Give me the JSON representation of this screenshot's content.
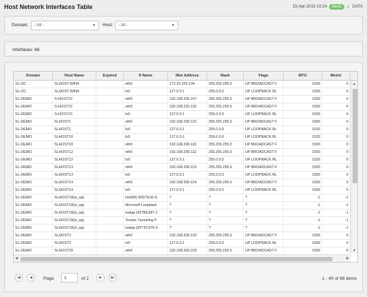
{
  "header": {
    "title": "Host Network Interfaces Table",
    "timestamp": "15-Apr-2019 10:24",
    "alerts_label": "Alerts",
    "data_label": "DATA"
  },
  "filters": {
    "domain_label": "Domain:",
    "domain_value": "- All -",
    "host_label": "Host:",
    "host_value": "- All -"
  },
  "summary": {
    "interfaces_label": "Interfaces: 66"
  },
  "table": {
    "columns": [
      "Domain",
      "Host Name",
      "Expired",
      "If Name",
      "INet Address",
      "Mask",
      "Flags",
      "MTU",
      "Metric"
    ],
    "rows": [
      [
        "SL-OC",
        "SLHOST-WIN4",
        "",
        "eth5",
        "172.16.200.134",
        "255.255.255.0",
        "UP BROADCAST F",
        "1500",
        "0"
      ],
      [
        "SL-OC",
        "SLHOST-WIN4",
        "",
        "lo0",
        "127.0.0.1",
        "255.0.0.0",
        "UP LOOPBACK RL",
        "1500",
        "0"
      ],
      [
        "SL-DEMO",
        "S-HOST10",
        "",
        "eth5",
        "192.168.200.167",
        "255.255.255.0",
        "UP BROADCAST F",
        "1500",
        "0"
      ],
      [
        "SL-DEMO",
        "S-HOST10",
        "",
        "eth9",
        "192.168.220.110",
        "255.255.255.0",
        "UP BROADCAST F",
        "1500",
        "0"
      ],
      [
        "SL-DEMO",
        "S-HOST10",
        "",
        "lo0",
        "127.0.0.1",
        "255.0.0.0",
        "UP LOOPBACK RL",
        "1500",
        "0"
      ],
      [
        "SL-DEMO",
        "SLHOST1",
        "",
        "eth0",
        "192.168.200.101",
        "255.255.255.0",
        "UP BROADCAST F",
        "1500",
        "0"
      ],
      [
        "SL-DEMO",
        "SLHOST1",
        "",
        "lo0",
        "127.0.0.1",
        "255.0.0.0",
        "UP LOOPBACK RL",
        "1520",
        "0"
      ],
      [
        "SL-DEMO",
        "SLHOST10",
        "",
        "lo0",
        "127.0.0.1",
        "255.0.0.0",
        "UP LOOPBACK RL",
        "1520",
        "0"
      ],
      [
        "SL-DEMO",
        "SLHOST10",
        "",
        "eth0",
        "192.168.200.110",
        "255.255.255.0",
        "UP BROADCAST F",
        "1500",
        "0"
      ],
      [
        "SL-DEMO",
        "SLHOST12",
        "",
        "eth0",
        "192.168.200.112",
        "255.255.255.0",
        "UP BROADCAST F",
        "1500",
        "0"
      ],
      [
        "SL-DEMO",
        "SLHOST12",
        "",
        "lo0",
        "127.0.0.1",
        "255.0.0.0",
        "UP LOOPBACK RL",
        "1520",
        "0"
      ],
      [
        "SL-DEMO",
        "SLHOST13",
        "",
        "eth6",
        "192.168.200.113",
        "255.255.255.0",
        "UP BROADCAST F",
        "1500",
        "0"
      ],
      [
        "SL-DEMO",
        "SLHOST13",
        "",
        "lo0",
        "127.0.0.1",
        "255.0.0.0",
        "UP LOOPBACK RL",
        "1500",
        "0"
      ],
      [
        "SL-DEMO",
        "SLHOST14",
        "",
        "eth6",
        "192.168.200.114",
        "255.255.255.0",
        "UP BROADCAST F",
        "1500",
        "0"
      ],
      [
        "SL-DEMO",
        "SLHOST14",
        "",
        "lo0",
        "127.0.0.1",
        "255.0.0.0",
        "UP LOOPBACK RL",
        "1500",
        "0"
      ],
      [
        "SL-DEMO",
        "SLHOST18(sl_qa)",
        "",
        "Intel(R) 82579LM G",
        "?",
        "?",
        "?",
        "-1",
        "-1"
      ],
      [
        "SL-DEMO",
        "SLHOST18(sl_qa)",
        "",
        "Microsoft Loopback",
        "?",
        "?",
        "?",
        "-1",
        "-1"
      ],
      [
        "SL-DEMO",
        "SLHOST18(sl_qa)",
        "",
        "isatap.{427BE387-1",
        "?",
        "?",
        "?",
        "-1",
        "-1"
      ],
      [
        "SL-DEMO",
        "SLHOST18(sl_qa)",
        "",
        "Teredo Tunneling P",
        "?",
        "?",
        "?",
        "-1",
        "-1"
      ],
      [
        "SL-DEMO",
        "SLHOST18(sl_qa)",
        "",
        "isatap.{3F73C479-3",
        "?",
        "?",
        "?",
        "-1",
        "-1"
      ],
      [
        "SL-DEMO",
        "SLHOST2",
        "",
        "eth0",
        "192.168.200.102",
        "255.255.255.0",
        "UP BROADCAST F",
        "1500",
        "0"
      ],
      [
        "SL-DEMO",
        "SLHOST2",
        "",
        "lo0",
        "127.0.0.1",
        "255.0.0.0",
        "UP LOOPBACK RL",
        "1500",
        "0"
      ],
      [
        "SL-DEMO",
        "SLHOST20",
        "",
        "eth6",
        "192.168.200.220",
        "255.255.255.0",
        "UP BROADCAST F",
        "1500",
        "0"
      ]
    ]
  },
  "pagination": {
    "page_label": "Page",
    "page_value": "1",
    "of_label": "of 2",
    "items_label": "1 - 40 of 66 items"
  }
}
